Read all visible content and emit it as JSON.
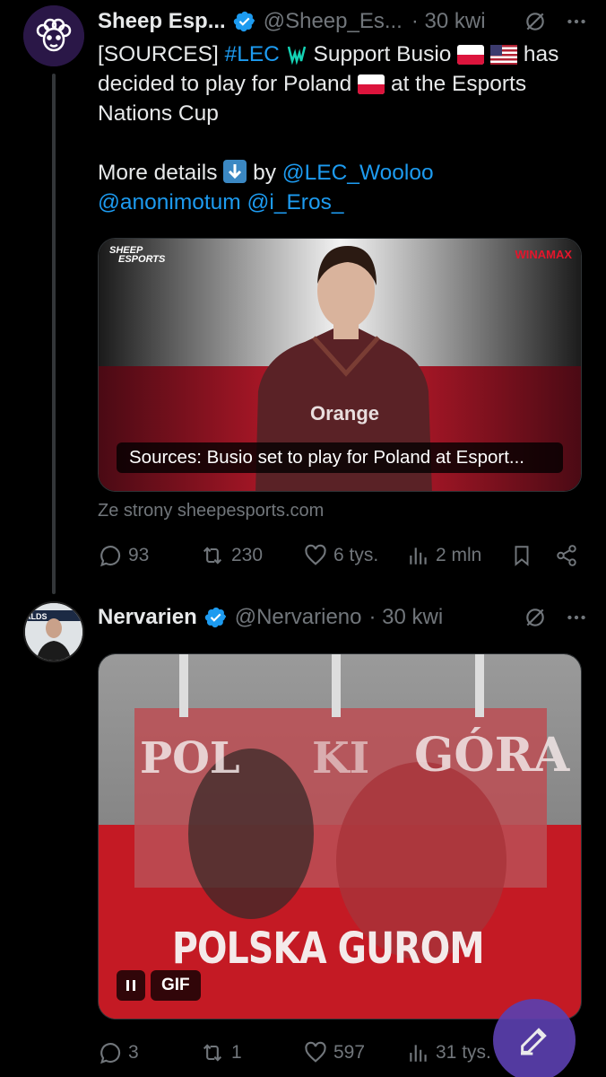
{
  "tweets": [
    {
      "author": "Sheep Esp...",
      "handle": "@Sheep_Es...",
      "time": "· 30 kwi",
      "text": {
        "sources": "[SOURCES]",
        "hashtag": "#LEC",
        "support": "Support Busio",
        "has": "has",
        "line2": "decided to play for Poland",
        "line2b": "at the Esports",
        "line3": "Nations Cup",
        "more": "More details",
        "by": "by",
        "mention1": "@LEC_Wooloo",
        "mention2": "@anonimotum",
        "mention3": "@i_Eros_"
      },
      "card": {
        "logo_top": "SHEEP",
        "logo_bottom": "ESPORTS",
        "sponsor": "WINAMAX",
        "jersey_text": "Orange",
        "caption": "Sources: Busio set to play for Poland at Esport..."
      },
      "domain": "Ze strony sheepesports.com",
      "stats": {
        "replies": "93",
        "reposts": "230",
        "likes": "6 tys.",
        "views": "2 mln"
      }
    },
    {
      "author": "Nervarien",
      "handle": "@Nervarieno",
      "time": "· 30 kwi",
      "avatar_text": "ALDS",
      "gif": {
        "banner_left": "POL",
        "banner_mid": "KI",
        "banner_right": "GÓRA",
        "bottom_text": "POLSKA GUROM",
        "label": "GIF"
      },
      "stats": {
        "replies": "3",
        "reposts": "1",
        "likes": "597",
        "views": "31 tys."
      }
    }
  ],
  "colors": {
    "link": "#1d9bf0",
    "muted": "#71767b",
    "fab": "#5b3fae"
  }
}
